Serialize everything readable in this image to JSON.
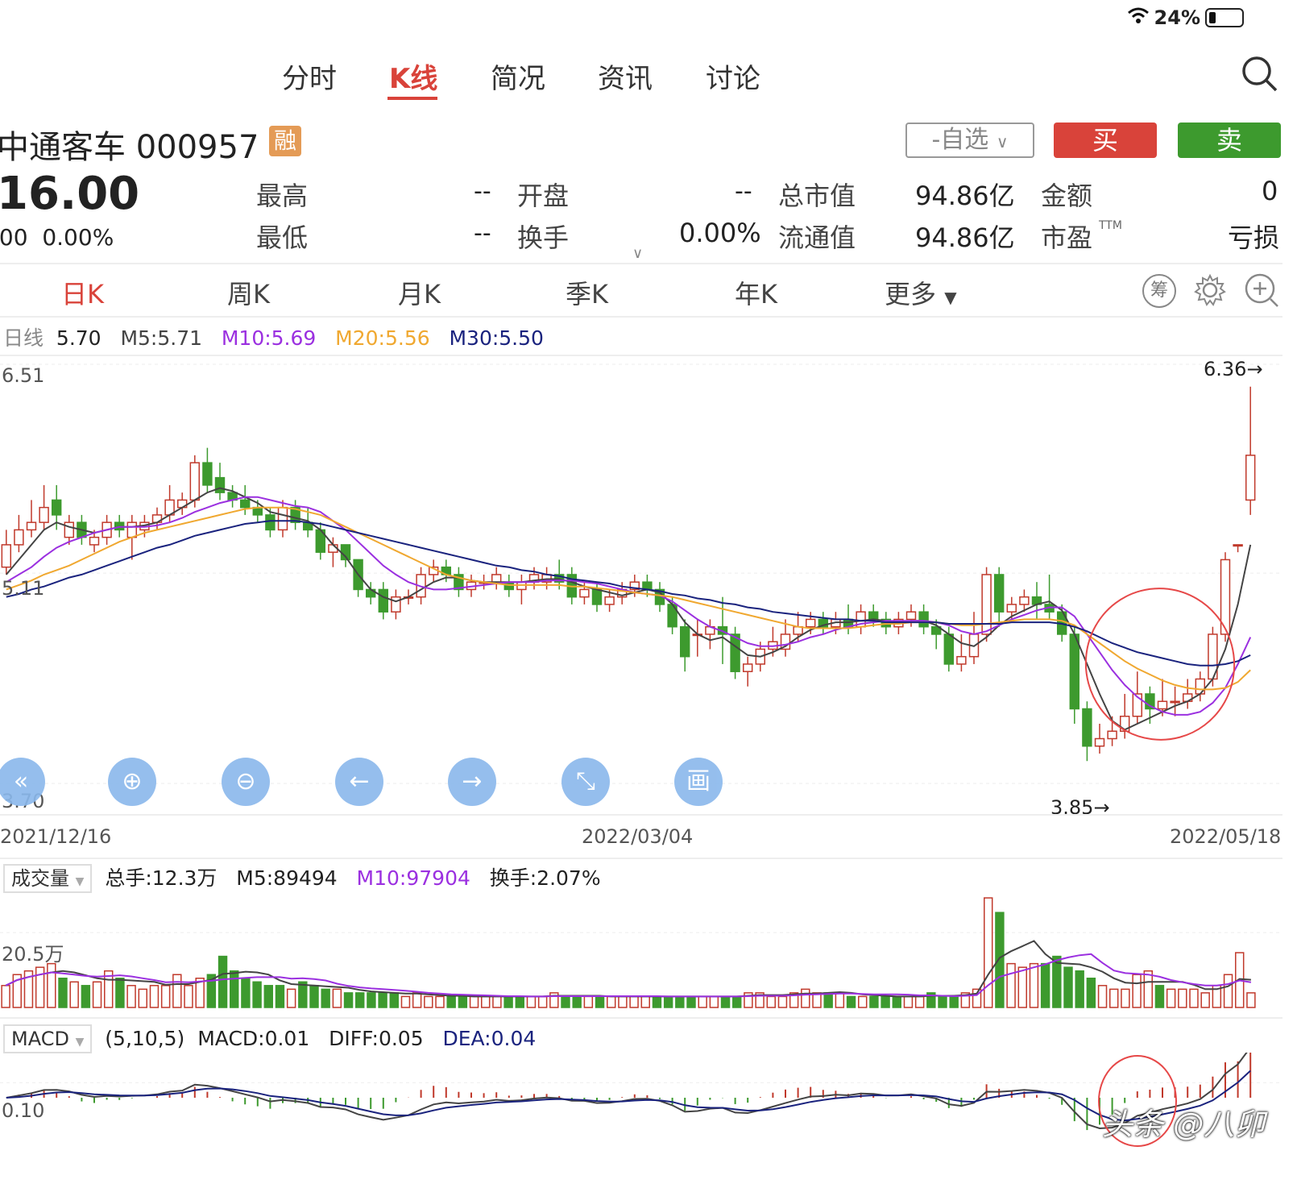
{
  "status": {
    "battery": "24%"
  },
  "nav": {
    "tabs": [
      {
        "label": "分时"
      },
      {
        "label": "K线"
      },
      {
        "label": "简况"
      },
      {
        "label": "资讯"
      },
      {
        "label": "讨论"
      }
    ]
  },
  "stock": {
    "name": "中通客车 000957",
    "badge": "融",
    "price": "16.00",
    "change": ".00",
    "change_pct": "0.00%"
  },
  "actions": {
    "watchlist": "-自选",
    "buy": "买",
    "sell": "卖"
  },
  "quote": {
    "high_label": "最高",
    "high_value": "--",
    "open_label": "开盘",
    "open_value": "--",
    "mktcap_label": "总市值",
    "mktcap_value": "94.86亿",
    "amount_label": "金额",
    "amount_value": "0",
    "low_label": "最低",
    "low_value": "--",
    "turnover_label": "换手",
    "turnover_value": "0.00%",
    "float_label": "流通值",
    "float_value": "94.86亿",
    "pe_label": "市盈",
    "pe_sup": "TTM",
    "pe_value": "亏损"
  },
  "ktabs": [
    {
      "label": "日K"
    },
    {
      "label": "周K"
    },
    {
      "label": "月K"
    },
    {
      "label": "季K"
    },
    {
      "label": "年K"
    },
    {
      "label": "更多"
    }
  ],
  "tools": {
    "chip": "筹"
  },
  "ma": {
    "label": "日线",
    "value": "5.70",
    "m5": "M5:5.71",
    "m10": "M10:5.69",
    "m20": "M20:5.56",
    "m30": "M30:5.50"
  },
  "colors": {
    "up": "#c0392b",
    "down": "#3d9a2e",
    "m5": "#444444",
    "m10": "#9b30e0",
    "m20": "#f0a830",
    "m30": "#1a237e",
    "accent": "#d9433a"
  },
  "chart_data": {
    "type": "candlestick",
    "y_ticks": [
      "6.51",
      "5.11",
      "3.70"
    ],
    "x_labels": [
      "2021/12/16",
      "2022/03/04",
      "2022/05/18"
    ],
    "high_mark": "6.36→",
    "low_mark": "3.85→",
    "ylim": [
      3.7,
      6.51
    ],
    "candles": [
      [
        5.15,
        5.3,
        5.1,
        5.4
      ],
      [
        5.3,
        5.4,
        5.25,
        5.5
      ],
      [
        5.4,
        5.45,
        5.35,
        5.6
      ],
      [
        5.45,
        5.55,
        5.4,
        5.7
      ],
      [
        5.6,
        5.5,
        5.4,
        5.7
      ],
      [
        5.35,
        5.45,
        5.3,
        5.5
      ],
      [
        5.45,
        5.35,
        5.3,
        5.5
      ],
      [
        5.3,
        5.35,
        5.25,
        5.4
      ],
      [
        5.35,
        5.45,
        5.3,
        5.5
      ],
      [
        5.45,
        5.4,
        5.35,
        5.5
      ],
      [
        5.35,
        5.45,
        5.2,
        5.5
      ],
      [
        5.4,
        5.45,
        5.35,
        5.5
      ],
      [
        5.45,
        5.5,
        5.4,
        5.55
      ],
      [
        5.5,
        5.6,
        5.45,
        5.7
      ],
      [
        5.55,
        5.6,
        5.5,
        5.65
      ],
      [
        5.6,
        5.85,
        5.55,
        5.9
      ],
      [
        5.85,
        5.7,
        5.65,
        5.95
      ],
      [
        5.75,
        5.65,
        5.6,
        5.85
      ],
      [
        5.65,
        5.6,
        5.55,
        5.7
      ],
      [
        5.6,
        5.55,
        5.5,
        5.7
      ],
      [
        5.55,
        5.5,
        5.45,
        5.6
      ],
      [
        5.5,
        5.4,
        5.35,
        5.55
      ],
      [
        5.4,
        5.55,
        5.35,
        5.6
      ],
      [
        5.55,
        5.45,
        5.4,
        5.6
      ],
      [
        5.45,
        5.4,
        5.35,
        5.55
      ],
      [
        5.4,
        5.25,
        5.2,
        5.45
      ],
      [
        5.25,
        5.3,
        5.15,
        5.35
      ],
      [
        5.3,
        5.2,
        5.15,
        5.3
      ],
      [
        5.2,
        5.0,
        4.95,
        5.2
      ],
      [
        5.0,
        4.95,
        4.9,
        5.05
      ],
      [
        5.0,
        4.85,
        4.8,
        5.05
      ],
      [
        4.85,
        4.95,
        4.8,
        5.0
      ],
      [
        4.95,
        4.95,
        4.9,
        5.0
      ],
      [
        4.95,
        5.1,
        4.9,
        5.15
      ],
      [
        5.1,
        5.15,
        5.05,
        5.2
      ],
      [
        5.15,
        5.1,
        5.05,
        5.2
      ],
      [
        5.1,
        5.0,
        4.95,
        5.15
      ],
      [
        5.0,
        5.05,
        4.95,
        5.1
      ],
      [
        5.05,
        5.05,
        5.0,
        5.1
      ],
      [
        5.05,
        5.1,
        5.0,
        5.15
      ],
      [
        5.05,
        5.0,
        4.95,
        5.1
      ],
      [
        5.0,
        5.05,
        4.9,
        5.1
      ],
      [
        5.05,
        5.1,
        5.0,
        5.15
      ],
      [
        5.05,
        5.1,
        5.0,
        5.15
      ],
      [
        5.1,
        5.05,
        5.0,
        5.2
      ],
      [
        5.1,
        4.95,
        4.9,
        5.15
      ],
      [
        4.95,
        5.0,
        4.9,
        5.05
      ],
      [
        5.0,
        4.9,
        4.85,
        5.05
      ],
      [
        4.9,
        4.95,
        4.85,
        5.0
      ],
      [
        4.95,
        5.0,
        4.9,
        5.05
      ],
      [
        5.0,
        5.05,
        4.95,
        5.1
      ],
      [
        5.05,
        5.0,
        4.95,
        5.1
      ],
      [
        5.0,
        4.9,
        4.85,
        5.05
      ],
      [
        4.9,
        4.75,
        4.7,
        4.95
      ],
      [
        4.75,
        4.55,
        4.45,
        4.8
      ],
      [
        4.7,
        4.7,
        4.55,
        4.8
      ],
      [
        4.7,
        4.75,
        4.6,
        4.8
      ],
      [
        4.75,
        4.7,
        4.5,
        4.95
      ],
      [
        4.7,
        4.45,
        4.4,
        4.75
      ],
      [
        4.45,
        4.5,
        4.35,
        4.55
      ],
      [
        4.5,
        4.6,
        4.45,
        4.65
      ],
      [
        4.6,
        4.65,
        4.55,
        4.75
      ],
      [
        4.6,
        4.7,
        4.55,
        4.8
      ],
      [
        4.7,
        4.75,
        4.65,
        4.85
      ],
      [
        4.75,
        4.8,
        4.7,
        4.85
      ],
      [
        4.8,
        4.75,
        4.7,
        4.85
      ],
      [
        4.75,
        4.8,
        4.7,
        4.85
      ],
      [
        4.8,
        4.75,
        4.7,
        4.9
      ],
      [
        4.75,
        4.85,
        4.7,
        4.9
      ],
      [
        4.85,
        4.8,
        4.75,
        4.9
      ],
      [
        4.8,
        4.75,
        4.7,
        4.85
      ],
      [
        4.75,
        4.8,
        4.7,
        4.85
      ],
      [
        4.8,
        4.85,
        4.75,
        4.9
      ],
      [
        4.85,
        4.75,
        4.7,
        4.9
      ],
      [
        4.75,
        4.7,
        4.6,
        4.8
      ],
      [
        4.7,
        4.5,
        4.45,
        4.75
      ],
      [
        4.5,
        4.55,
        4.45,
        4.7
      ],
      [
        4.55,
        4.7,
        4.5,
        4.85
      ],
      [
        4.7,
        5.1,
        4.65,
        5.15
      ],
      [
        5.1,
        4.85,
        4.75,
        5.15
      ],
      [
        4.85,
        4.9,
        4.8,
        4.95
      ],
      [
        4.9,
        4.95,
        4.85,
        5.0
      ],
      [
        4.95,
        4.9,
        4.8,
        5.05
      ],
      [
        4.9,
        4.85,
        4.8,
        5.1
      ],
      [
        4.85,
        4.7,
        4.65,
        4.9
      ],
      [
        4.7,
        4.2,
        4.1,
        4.75
      ],
      [
        4.2,
        3.95,
        3.85,
        4.25
      ],
      [
        3.95,
        4.0,
        3.9,
        4.1
      ],
      [
        4.0,
        4.05,
        3.95,
        4.15
      ],
      [
        4.05,
        4.15,
        4.0,
        4.3
      ],
      [
        4.15,
        4.3,
        4.1,
        4.45
      ],
      [
        4.3,
        4.2,
        4.1,
        4.35
      ],
      [
        4.2,
        4.25,
        4.15,
        4.4
      ],
      [
        4.25,
        4.25,
        4.15,
        4.35
      ],
      [
        4.25,
        4.3,
        4.2,
        4.4
      ],
      [
        4.3,
        4.4,
        4.25,
        4.45
      ],
      [
        4.4,
        4.7,
        4.35,
        4.75
      ],
      [
        4.7,
        5.2,
        4.65,
        5.25
      ],
      [
        5.3,
        5.3,
        5.25,
        5.3
      ],
      [
        5.6,
        5.9,
        5.5,
        6.36
      ]
    ],
    "ma5": [
      5.1,
      5.2,
      5.3,
      5.4,
      5.45,
      5.42,
      5.4,
      5.38,
      5.4,
      5.42,
      5.42,
      5.43,
      5.45,
      5.5,
      5.55,
      5.6,
      5.65,
      5.68,
      5.66,
      5.62,
      5.58,
      5.52,
      5.5,
      5.48,
      5.46,
      5.4,
      5.3,
      5.22,
      5.1,
      5.0,
      4.95,
      4.92,
      4.95,
      5.0,
      5.05,
      5.08,
      5.08,
      5.06,
      5.05,
      5.05,
      5.05,
      5.05,
      5.06,
      5.07,
      5.07,
      5.05,
      5.02,
      5.0,
      4.98,
      4.96,
      4.98,
      5.0,
      4.98,
      4.9,
      4.78,
      4.7,
      4.66,
      4.68,
      4.62,
      4.56,
      4.55,
      4.58,
      4.62,
      4.68,
      4.73,
      4.76,
      4.78,
      4.78,
      4.79,
      4.8,
      4.79,
      4.78,
      4.79,
      4.79,
      4.76,
      4.7,
      4.64,
      4.62,
      4.68,
      4.76,
      4.82,
      4.86,
      4.9,
      4.92,
      4.86,
      4.7,
      4.5,
      4.3,
      4.12,
      4.06,
      4.1,
      4.14,
      4.18,
      4.22,
      4.25,
      4.3,
      4.4,
      4.6,
      4.9,
      5.3
    ],
    "ma10": [
      5.05,
      5.1,
      5.15,
      5.22,
      5.28,
      5.32,
      5.35,
      5.38,
      5.4,
      5.42,
      5.42,
      5.42,
      5.43,
      5.45,
      5.48,
      5.52,
      5.55,
      5.58,
      5.6,
      5.62,
      5.62,
      5.6,
      5.58,
      5.56,
      5.55,
      5.52,
      5.46,
      5.4,
      5.32,
      5.24,
      5.16,
      5.1,
      5.05,
      5.02,
      5.0,
      5.0,
      5.01,
      5.02,
      5.03,
      5.04,
      5.05,
      5.05,
      5.05,
      5.06,
      5.06,
      5.06,
      5.05,
      5.04,
      5.02,
      5.0,
      4.98,
      4.97,
      4.96,
      4.92,
      4.86,
      4.8,
      4.75,
      4.72,
      4.68,
      4.64,
      4.62,
      4.62,
      4.63,
      4.65,
      4.68,
      4.7,
      4.73,
      4.75,
      4.77,
      4.78,
      4.79,
      4.79,
      4.79,
      4.79,
      4.78,
      4.76,
      4.72,
      4.7,
      4.72,
      4.76,
      4.8,
      4.83,
      4.86,
      4.88,
      4.88,
      4.82,
      4.7,
      4.58,
      4.46,
      4.36,
      4.28,
      4.22,
      4.18,
      4.16,
      4.16,
      4.18,
      4.24,
      4.34,
      4.5,
      4.68
    ],
    "ma20": [
      5.0,
      5.03,
      5.06,
      5.1,
      5.13,
      5.16,
      5.2,
      5.24,
      5.28,
      5.32,
      5.35,
      5.38,
      5.4,
      5.42,
      5.44,
      5.46,
      5.48,
      5.5,
      5.52,
      5.54,
      5.55,
      5.55,
      5.55,
      5.54,
      5.52,
      5.5,
      5.46,
      5.42,
      5.38,
      5.34,
      5.3,
      5.26,
      5.22,
      5.18,
      5.14,
      5.1,
      5.08,
      5.06,
      5.05,
      5.04,
      5.03,
      5.03,
      5.03,
      5.03,
      5.03,
      5.02,
      5.02,
      5.01,
      5.0,
      4.99,
      4.98,
      4.97,
      4.96,
      4.95,
      4.93,
      4.91,
      4.89,
      4.87,
      4.85,
      4.83,
      4.81,
      4.79,
      4.77,
      4.75,
      4.74,
      4.74,
      4.74,
      4.74,
      4.75,
      4.76,
      4.77,
      4.77,
      4.78,
      4.78,
      4.78,
      4.77,
      4.76,
      4.76,
      4.77,
      4.78,
      4.79,
      4.8,
      4.8,
      4.8,
      4.79,
      4.76,
      4.7,
      4.64,
      4.58,
      4.52,
      4.47,
      4.43,
      4.39,
      4.36,
      4.34,
      4.33,
      4.33,
      4.34,
      4.38,
      4.46
    ],
    "ma30": [
      4.95,
      4.97,
      5.0,
      5.02,
      5.05,
      5.08,
      5.1,
      5.13,
      5.16,
      5.19,
      5.22,
      5.25,
      5.28,
      5.3,
      5.33,
      5.36,
      5.38,
      5.4,
      5.42,
      5.44,
      5.45,
      5.46,
      5.46,
      5.46,
      5.45,
      5.44,
      5.42,
      5.4,
      5.38,
      5.36,
      5.34,
      5.32,
      5.3,
      5.28,
      5.26,
      5.24,
      5.22,
      5.2,
      5.18,
      5.16,
      5.15,
      5.13,
      5.12,
      5.1,
      5.09,
      5.07,
      5.06,
      5.05,
      5.04,
      5.02,
      5.01,
      5.0,
      4.99,
      4.97,
      4.96,
      4.94,
      4.93,
      4.91,
      4.9,
      4.88,
      4.87,
      4.85,
      4.84,
      4.83,
      4.82,
      4.81,
      4.8,
      4.8,
      4.79,
      4.79,
      4.78,
      4.78,
      4.78,
      4.78,
      4.78,
      4.77,
      4.77,
      4.77,
      4.77,
      4.77,
      4.78,
      4.78,
      4.78,
      4.78,
      4.77,
      4.75,
      4.72,
      4.68,
      4.64,
      4.61,
      4.58,
      4.56,
      4.54,
      4.52,
      4.5,
      4.49,
      4.49,
      4.5,
      4.52,
      4.56
    ]
  },
  "volume": {
    "selector": "成交量",
    "total": "总手:12.3万",
    "m5": "M5:89494",
    "m10": "M10:97904",
    "turnover": "换手:2.07%",
    "y_tick": "20.5万",
    "values": [
      6,
      9,
      10,
      11,
      12,
      8,
      7,
      6,
      7,
      10,
      8,
      6,
      5,
      6,
      6,
      9,
      6,
      8,
      9,
      14,
      10,
      8,
      7,
      6,
      6,
      5,
      7,
      6,
      5,
      5,
      4,
      4,
      4,
      4,
      4,
      3,
      4,
      3,
      3,
      3,
      3,
      3,
      3,
      3,
      3,
      3,
      3,
      3,
      4,
      3,
      3,
      3,
      3,
      3,
      3,
      3,
      3,
      3,
      3,
      3,
      3,
      3,
      3,
      3,
      3,
      4,
      4,
      3,
      3,
      4,
      5,
      4,
      4,
      4,
      3,
      3,
      3,
      3,
      3,
      3,
      3,
      4,
      3,
      3,
      4,
      5,
      30,
      26,
      12,
      11,
      12,
      12,
      14,
      11,
      10,
      8,
      6,
      5,
      5,
      9,
      10,
      6,
      5,
      5,
      5,
      4,
      6,
      9,
      15,
      4
    ]
  },
  "macd": {
    "selector": "MACD",
    "params": "(5,10,5)",
    "macd": "MACD:0.01",
    "diff": "DIFF:0.05",
    "dea": "DEA:0.04",
    "y_tick": "0.10"
  },
  "watermark": "头条 @八卯"
}
